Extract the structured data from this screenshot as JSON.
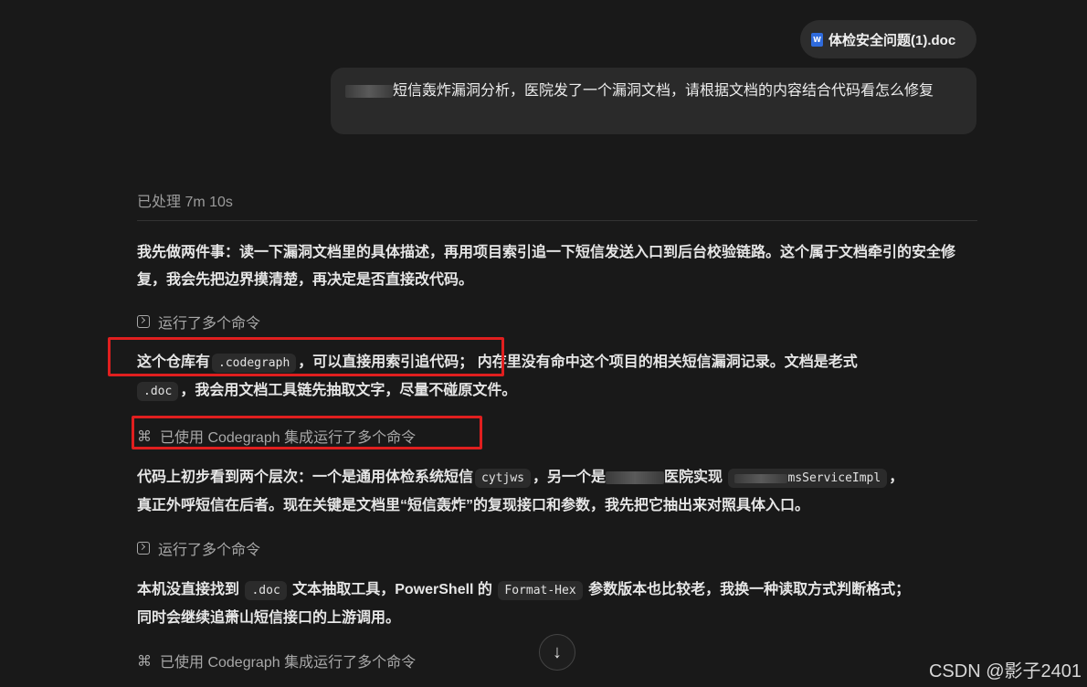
{
  "attachment": {
    "filename": "体检安全问题(1).doc",
    "icon": "word-doc-icon"
  },
  "user_message": {
    "text": "短信轰炸漏洞分析，医院发了一个漏洞文档，请根据文档的内容结合代码看怎么修复"
  },
  "status": {
    "processed": "已处理 7m 10s"
  },
  "para1": {
    "text": "我先做两件事：读一下漏洞文档里的具体描述，再用项目索引追一下短信发送入口到后台校验链路。这个属于文档牵引的安全修复，我会先把边界摸清楚，再决定是否直接改代码。"
  },
  "cmd1": {
    "label": "运行了多个命令",
    "icon": "terminal-icon"
  },
  "para2": {
    "t1": "这个仓库有",
    "code1": ".codegraph",
    "t2": "，可以直接用索引追代码；",
    "t3": "内存里没有命中这个项目的相关短信漏洞记录。文档是老式",
    "code2": ".doc",
    "t4": "，我会用文档工具链先抽取文字，尽量不碰原文件。"
  },
  "cmd2": {
    "label": "已使用 Codegraph 集成运行了多个命令",
    "icon": "command-icon"
  },
  "para3": {
    "t1": "代码上初步看到两个层次：一个是通用体检系统短信",
    "code1": "cytjws",
    "t2": "，另一个是",
    "t3": "医院实现",
    "code2": "msServiceImpl",
    "t4": "，",
    "t5": "真正外呼短信在后者。现在关键是文档里“短信轰炸”的复现接口和参数，我先把它抽出来对照具体入口。"
  },
  "cmd3": {
    "label": "运行了多个命令",
    "icon": "terminal-icon"
  },
  "para4": {
    "t1": "本机没直接找到",
    "code1": ".doc",
    "t2": "文本抽取工具，PowerShell 的",
    "code2": "Format-Hex",
    "t3": "参数版本也比较老，我换一种读取方式判断格式；",
    "t4": "同时会继续追萧山短信接口的上游调用。"
  },
  "cmd4": {
    "label": "已使用 Codegraph 集成运行了多个命令",
    "icon": "command-icon"
  },
  "scroll": {
    "icon": "arrow-down-icon",
    "glyph": "↓"
  },
  "watermark": {
    "text": "CSDN @影子2401"
  }
}
